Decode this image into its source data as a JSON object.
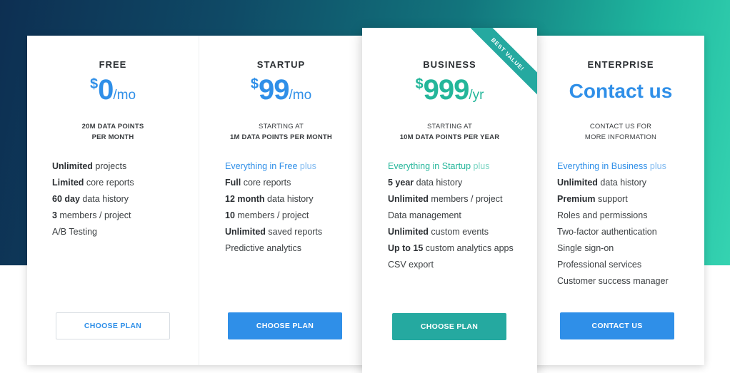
{
  "colors": {
    "accent_blue": "#2f8fe8",
    "accent_teal": "#24b69a",
    "button_teal": "#25a9a0"
  },
  "plans": [
    {
      "name": "FREE",
      "currency": "$",
      "amount": "0",
      "period": "/mo",
      "sub_line1": "20M DATA POINTS",
      "sub_line2": "PER MONTH",
      "features": [
        {
          "bold": "Unlimited",
          "rest": " projects"
        },
        {
          "bold": "Limited",
          "rest": " core reports"
        },
        {
          "bold": "60 day",
          "rest": " data history"
        },
        {
          "bold": "3",
          "rest": " members / project"
        },
        {
          "bold": "",
          "rest": "A/B Testing"
        }
      ],
      "button_label": "CHOOSE PLAN"
    },
    {
      "name": "STARTUP",
      "currency": "$",
      "amount": "99",
      "period": "/mo",
      "sub_line1": "STARTING AT",
      "sub_line2": "1M DATA POINTS PER MONTH",
      "intro": {
        "text": "Everything in Free",
        "plus": " plus"
      },
      "features": [
        {
          "bold": "Full",
          "rest": " core reports"
        },
        {
          "bold": "12 month",
          "rest": " data history"
        },
        {
          "bold": "10",
          "rest": " members / project"
        },
        {
          "bold": "Unlimited",
          "rest": " saved reports"
        },
        {
          "bold": "",
          "rest": "Predictive analytics"
        }
      ],
      "button_label": "CHOOSE PLAN"
    },
    {
      "name": "BUSINESS",
      "currency": "$",
      "amount": "999",
      "period": "/yr",
      "sub_line1": "STARTING AT",
      "sub_line2": "10M DATA POINTS PER YEAR",
      "ribbon": "BEST VALUE!",
      "intro": {
        "text": "Everything in Startup",
        "plus": " plus"
      },
      "features": [
        {
          "bold": "5 year",
          "rest": " data history"
        },
        {
          "bold": "Unlimited",
          "rest": " members / project"
        },
        {
          "bold": "",
          "rest": "Data management"
        },
        {
          "bold": "Unlimited",
          "rest": " custom events"
        },
        {
          "bold": "Up to 15",
          "rest": " custom analytics apps"
        },
        {
          "bold": "",
          "rest": "CSV export"
        }
      ],
      "button_label": "CHOOSE PLAN"
    },
    {
      "name": "ENTERPRISE",
      "price_text": "Contact us",
      "sub_line1": "CONTACT US FOR",
      "sub_line2": "MORE INFORMATION",
      "intro": {
        "text": "Everything in Business",
        "plus": " plus"
      },
      "features": [
        {
          "bold": "Unlimited",
          "rest": " data history"
        },
        {
          "bold": "Premium",
          "rest": " support"
        },
        {
          "bold": "",
          "rest": "Roles and permissions"
        },
        {
          "bold": "",
          "rest": "Two-factor authentication"
        },
        {
          "bold": "",
          "rest": "Single sign-on"
        },
        {
          "bold": "",
          "rest": "Professional services"
        },
        {
          "bold": "",
          "rest": "Customer success manager"
        }
      ],
      "button_label": "CONTACT US"
    }
  ]
}
